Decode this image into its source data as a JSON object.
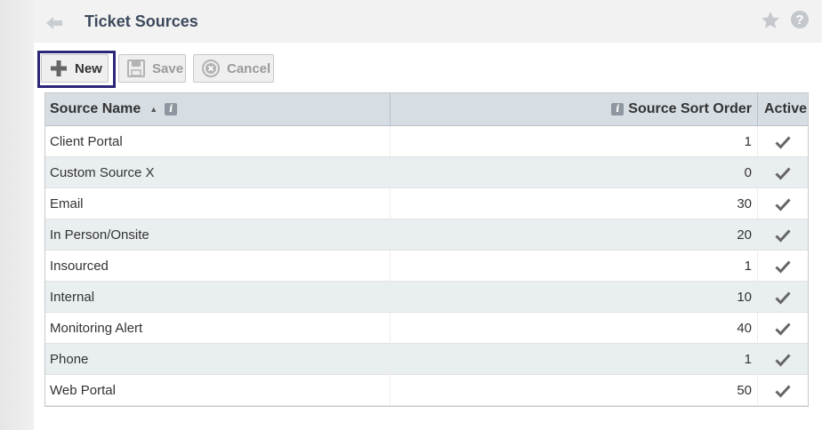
{
  "header": {
    "title": "Ticket Sources",
    "back_icon": "back-arrow-icon",
    "star_icon": "star-icon",
    "help_icon": "help-icon"
  },
  "toolbar": {
    "new_label": "New",
    "save_label": "Save",
    "cancel_label": "Cancel"
  },
  "grid": {
    "columns": {
      "name": "Source Name",
      "sort_order": "Source Sort Order",
      "active": "Active"
    },
    "sort": {
      "column": "Source Name",
      "direction": "ascending"
    },
    "rows": [
      {
        "name": "Client Portal",
        "sort_order": "1",
        "active": true
      },
      {
        "name": "Custom Source X",
        "sort_order": "0",
        "active": true
      },
      {
        "name": "Email",
        "sort_order": "30",
        "active": true
      },
      {
        "name": "In Person/Onsite",
        "sort_order": "20",
        "active": true
      },
      {
        "name": "Insourced",
        "sort_order": "1",
        "active": true
      },
      {
        "name": "Internal",
        "sort_order": "10",
        "active": true
      },
      {
        "name": "Monitoring Alert",
        "sort_order": "40",
        "active": true
      },
      {
        "name": "Phone",
        "sort_order": "1",
        "active": true
      },
      {
        "name": "Web Portal",
        "sort_order": "50",
        "active": true
      }
    ]
  },
  "colors": {
    "title": "#3d4a5c",
    "header_bg": "#d6dde3",
    "alt_row_bg": "#e9eef0",
    "focus_border": "#2c2678"
  }
}
